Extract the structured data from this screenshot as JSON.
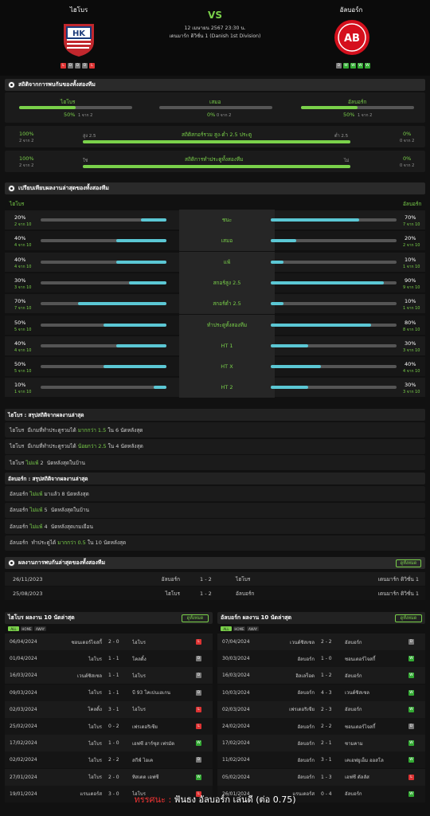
{
  "header": {
    "home": "ไฮโบร",
    "away": "อัลบอร์ก",
    "vs": "VS",
    "date": "12 เมษายน 2567 23:30 น.",
    "league": "เดนมาร์ก ดิวิชั่น 1 (Danish 1st Division)",
    "home_form": [
      "L",
      "D",
      "D",
      "D",
      "L"
    ],
    "away_form": [
      "D",
      "W",
      "W",
      "W",
      "W"
    ],
    "home_logo": "HK",
    "away_logo": "AB"
  },
  "h2h_stats": {
    "title": "สถิติจากการพบกันของทั้งสองทีม",
    "home_label": "ไฮโบร",
    "home_pct": "50%",
    "home_sub": "1 จาก 2",
    "draw_label": "เสมอ",
    "draw_pct": "0%",
    "draw_sub": "0 จาก 2",
    "away_label": "อัลบอร์ก",
    "away_pct": "50%",
    "away_sub": "1 จาก 2",
    "over_left_pct": "100%",
    "over_left_sub": "2 จาก 2",
    "over_title": "สถิติสกอร์รวม สูง-ต่ำ 2.5 ประตู",
    "over_l": "สูง 2.5",
    "over_r": "ต่ำ 2.5",
    "over_right_pct": "0%",
    "over_right_sub": "0 จาก 2",
    "btts_left_pct": "100%",
    "btts_left_sub": "2 จาก 2",
    "btts_title": "สถิติการทำประตูทั้งสองทีม",
    "btts_l": "ใช่",
    "btts_r": "ไม่",
    "btts_right_pct": "0%",
    "btts_right_sub": "0 จาก 2",
    "home_val": 0.5,
    "draw_val": 0,
    "away_val": 0.5,
    "over_val": 1.0,
    "btts_val": 1.0
  },
  "compare": {
    "title": "เปรียบเทียบผลงานล่าสุดของทั้งสองทีม",
    "home": "ไฮโบร",
    "away": "อัลบอร์ก",
    "rows": [
      {
        "label": "ชนะ",
        "lp": "20%",
        "ls": "2 จาก 10",
        "lv": 0.2,
        "rp": "70%",
        "rs": "7 จาก 10",
        "rv": 0.7
      },
      {
        "label": "เสมอ",
        "lp": "40%",
        "ls": "4 จาก 10",
        "lv": 0.4,
        "rp": "20%",
        "rs": "2 จาก 10",
        "rv": 0.2
      },
      {
        "label": "แพ้",
        "lp": "40%",
        "ls": "4 จาก 10",
        "lv": 0.4,
        "rp": "10%",
        "rs": "1 จาก 10",
        "rv": 0.1
      },
      {
        "label": "สกอร์สูง 2.5",
        "lp": "30%",
        "ls": "3 จาก 10",
        "lv": 0.3,
        "rp": "90%",
        "rs": "9 จาก 10",
        "rv": 0.9
      },
      {
        "label": "สกอร์ต่ำ 2.5",
        "lp": "70%",
        "ls": "7 จาก 10",
        "lv": 0.7,
        "rp": "10%",
        "rs": "1 จาก 10",
        "rv": 0.1
      },
      {
        "label": "ทำประตูทั้งสองทีม",
        "lp": "50%",
        "ls": "5 จาก 10",
        "lv": 0.5,
        "rp": "80%",
        "rs": "8 จาก 10",
        "rv": 0.8
      },
      {
        "label": "HT 1",
        "lp": "40%",
        "ls": "4 จาก 10",
        "lv": 0.4,
        "rp": "30%",
        "rs": "3 จาก 10",
        "rv": 0.3
      },
      {
        "label": "HT X",
        "lp": "50%",
        "ls": "5 จาก 10",
        "lv": 0.5,
        "rp": "40%",
        "rs": "4 จาก 10",
        "rv": 0.4
      },
      {
        "label": "HT 2",
        "lp": "10%",
        "ls": "1 จาก 10",
        "lv": 0.1,
        "rp": "30%",
        "rs": "3 จาก 10",
        "rv": 0.3
      }
    ]
  },
  "home_summary": {
    "title": "ไฮโบร : สรุปสถิติจากผลงานล่าสุด",
    "lines": [
      [
        "ไฮโบร  มีเกมที่ทำประตูรวมได้ ",
        "มากกว่า 1.5",
        " ใน 6 นัดหลังสุด"
      ],
      [
        "ไฮโบร  มีเกมที่ทำประตูรวมได้ ",
        "น้อยกว่า 2.5",
        " ใน 4 นัดหลังสุด"
      ],
      [
        "ไฮโบร ",
        "ไม่แพ้",
        " 2  นัดหลังสุดในบ้าน"
      ]
    ]
  },
  "away_summary": {
    "title": "อัลบอร์ก : สรุปสถิติจากผลงานล่าสุด",
    "lines": [
      [
        "อัลบอร์ก ",
        "ไม่แพ้",
        " มาแล้ว 8 นัดหลังสุด"
      ],
      [
        "อัลบอร์ก ",
        "ไม่แพ้",
        " 5  นัดหลังสุดในบ้าน"
      ],
      [
        "อัลบอร์ก ",
        "ไม่แพ้",
        " 4  นัดหลังสุดเกมเยือน"
      ],
      [
        "อัลบอร์ก  ทำประตูได้ ",
        "มากกว่า 0.5",
        " ใน 10 นัดหลังสุด"
      ]
    ]
  },
  "h2h": {
    "title": "ผลงานการพบกันล่าสุดของทั้งสองทีม",
    "button": "ดูทั้งหมด",
    "rows": [
      {
        "date": "26/11/2023",
        "home": "อัลบอร์ก",
        "score": "1 - 2",
        "away": "ไฮโบร",
        "league": "เดนมาร์ก ดิวิชั่น 1"
      },
      {
        "date": "25/08/2023",
        "home": "ไฮโบร",
        "score": "1 - 2",
        "away": "อัลบอร์ก",
        "league": "เดนมาร์ก ดิวิชั่น 1"
      }
    ]
  },
  "home_last": {
    "title": "ไฮโบร ผลงาน 10 นัดล่าสุด",
    "button": "ดูทั้งหมด",
    "tabs": [
      "ALL",
      "HOME",
      "AWAY"
    ],
    "rows": [
      {
        "d": "06/04/2024",
        "h": "ซอนเดอร์ไจสกี้",
        "s": "2 - 0",
        "a": "ไฮโบร",
        "r": "L"
      },
      {
        "d": "01/04/2024",
        "h": "ไฮโบร",
        "s": "1 - 1",
        "a": "โคลดิ้ง",
        "r": "D"
      },
      {
        "d": "16/03/2024",
        "h": "เวนด์ซิสเซล",
        "s": "1 - 1",
        "a": "ไฮโบร",
        "r": "D"
      },
      {
        "d": "09/03/2024",
        "h": "ไฮโบร",
        "s": "1 - 1",
        "a": "บี 93 โคเปนเฮเกน",
        "r": "D"
      },
      {
        "d": "02/03/2024",
        "h": "โคลดิ้ง",
        "s": "3 - 1",
        "a": "ไฮโบร",
        "r": "L"
      },
      {
        "d": "25/02/2024",
        "h": "ไฮโบร",
        "s": "0 - 2",
        "a": "เฟรเดอริเซีย",
        "r": "L"
      },
      {
        "d": "17/02/2024",
        "h": "ไฮโบร",
        "s": "1 - 0",
        "a": "เอฟซี ฮาร์ซุส เฟรมัด",
        "r": "W"
      },
      {
        "d": "02/02/2024",
        "h": "ไฮโบร",
        "s": "2 - 2",
        "a": "สกีฟ์ ไอเค",
        "r": "D"
      },
      {
        "d": "27/01/2024",
        "h": "ไฮโบร",
        "s": "2 - 0",
        "a": "ทิสเตด เอฟซี",
        "r": "W"
      },
      {
        "d": "19/01/2024",
        "h": "แรนเดอร์ส",
        "s": "3 - 0",
        "a": "ไฮโบร",
        "r": "L"
      }
    ]
  },
  "away_last": {
    "title": "อัลบอร์ก ผลงาน 10 นัดล่าสุด",
    "button": "ดูทั้งหมด",
    "tabs": [
      "ALL",
      "HOME",
      "AWAY"
    ],
    "rows": [
      {
        "d": "07/04/2024",
        "h": "เวนด์ซิสเซล",
        "s": "2 - 2",
        "a": "อัลบอร์ก",
        "r": "D"
      },
      {
        "d": "30/03/2024",
        "h": "อัลบอร์ก",
        "s": "1 - 0",
        "a": "ซอนเดอร์ไจสกี้",
        "r": "W"
      },
      {
        "d": "16/03/2024",
        "h": "ฮิลเลร็อด",
        "s": "1 - 2",
        "a": "อัลบอร์ก",
        "r": "W"
      },
      {
        "d": "10/03/2024",
        "h": "อัลบอร์ก",
        "s": "4 - 3",
        "a": "เวนด์ซิสเซล",
        "r": "W"
      },
      {
        "d": "02/03/2024",
        "h": "เฟรเดอริเซีย",
        "s": "2 - 3",
        "a": "อัลบอร์ก",
        "r": "W"
      },
      {
        "d": "24/02/2024",
        "h": "อัลบอร์ก",
        "s": "2 - 2",
        "a": "ซอนเดอร์ไจสกี้",
        "r": "D"
      },
      {
        "d": "17/02/2024",
        "h": "อัลบอร์ก",
        "s": "2 - 1",
        "a": "ซามคาม",
        "r": "W"
      },
      {
        "d": "11/02/2024",
        "h": "อัลบอร์ก",
        "s": "3 - 1",
        "a": "เคเอฟยูเอ็ม ออสโล",
        "r": "W"
      },
      {
        "d": "05/02/2024",
        "h": "อัลบอร์ก",
        "s": "1 - 3",
        "a": "เอฟซี ดัลลัส",
        "r": "L"
      },
      {
        "d": "26/01/2024",
        "h": "แรนเดอร์ส",
        "s": "0 - 4",
        "a": "อัลบอร์ก",
        "r": "W"
      }
    ]
  },
  "prediction": {
    "label": "ทรรศนะ :",
    "text": " ฟันธง อัลบอร์ก เล่นดี (ต่อ 0.75)"
  },
  "colors": {
    "accent": "#7ad14a",
    "cyan": "#5bc7d4",
    "win": "#33aa33",
    "loss": "#dd3333",
    "draw": "#777777"
  }
}
